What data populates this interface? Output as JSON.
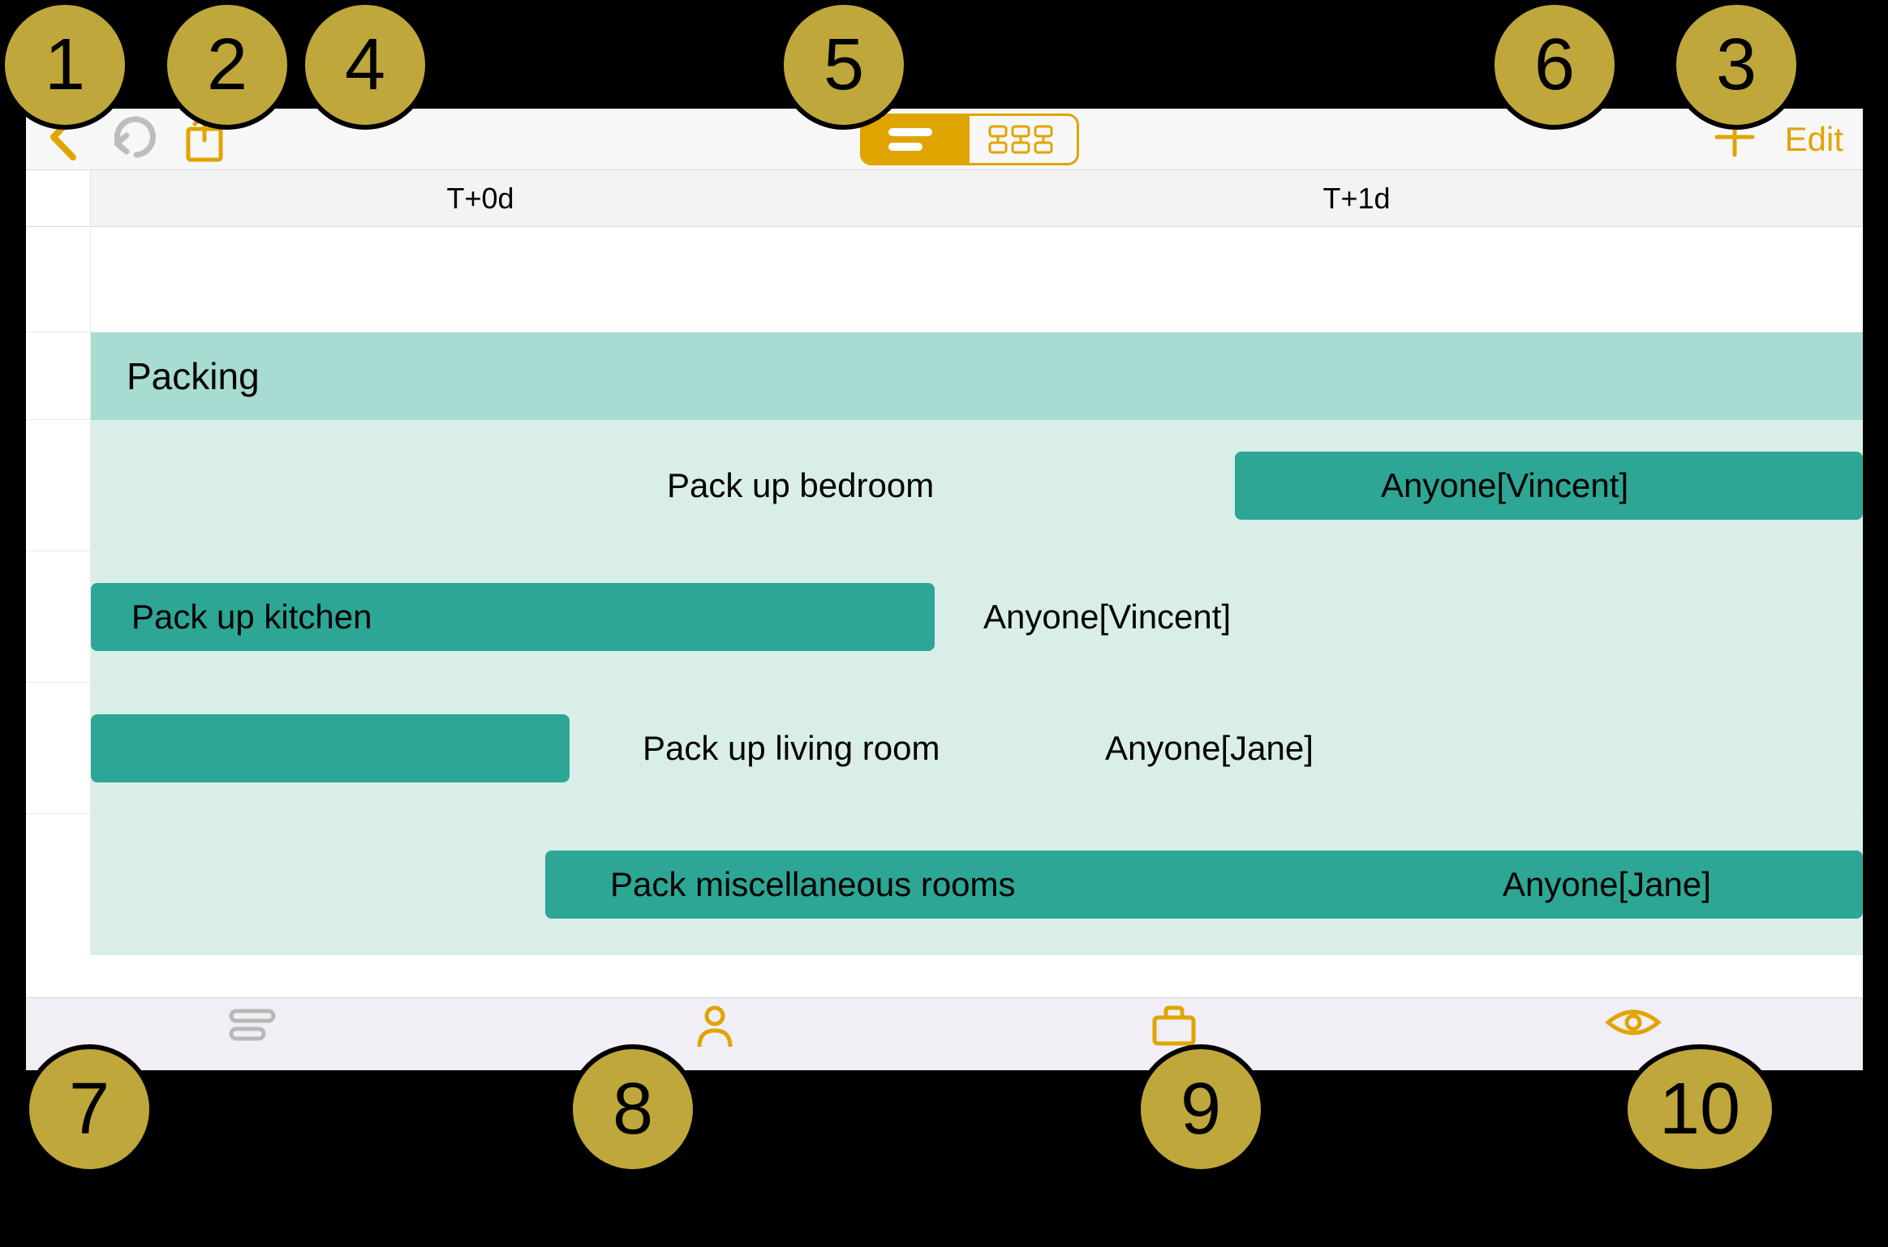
{
  "toolbar": {
    "edit_label": "Edit"
  },
  "timeline": {
    "columns": [
      "T+0d",
      "T+1d"
    ]
  },
  "group": {
    "title": "Packing"
  },
  "tasks": [
    {
      "name": "Pack up bedroom",
      "assignee": "Anyone[Vincent]"
    },
    {
      "name": "Pack up kitchen",
      "assignee": "Anyone[Vincent]"
    },
    {
      "name": "Pack up living room",
      "assignee": "Anyone[Jane]"
    },
    {
      "name": "Pack miscellaneous rooms",
      "assignee": "Anyone[Jane]"
    }
  ],
  "callouts": [
    "1",
    "2",
    "3",
    "4",
    "5",
    "6",
    "7",
    "8",
    "9",
    "10"
  ],
  "colors": {
    "accent": "#e0a400",
    "group_header": "#a8dcd3",
    "group_bg": "#d9eee9",
    "task_bar": "#2da695"
  }
}
